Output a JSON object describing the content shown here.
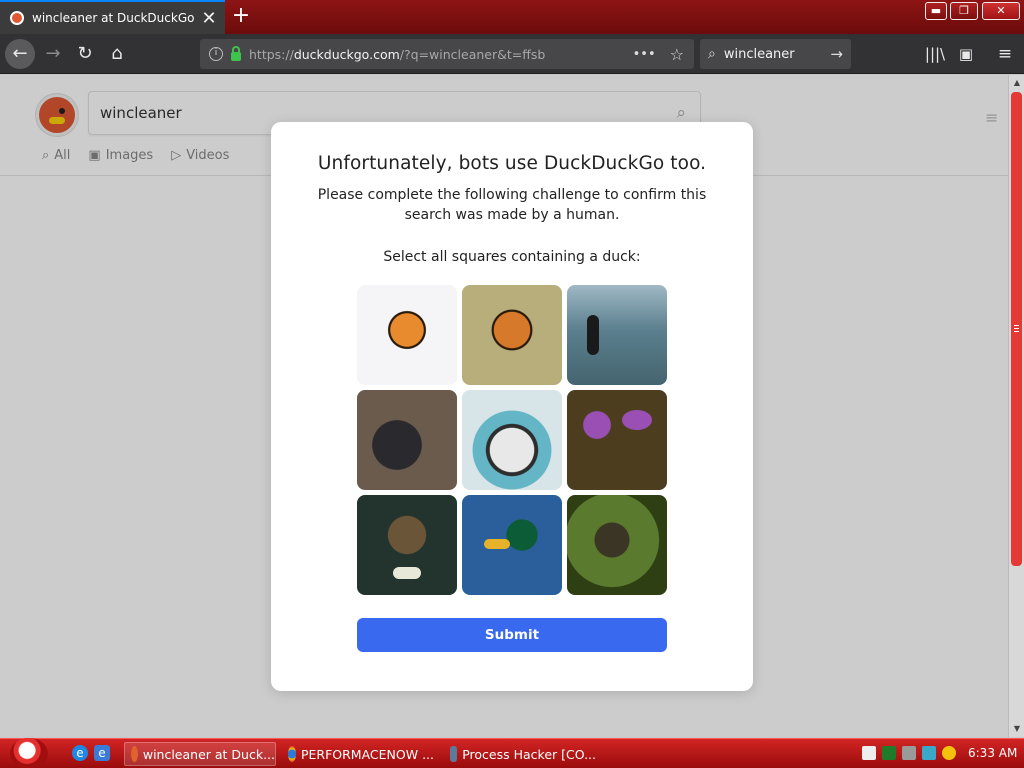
{
  "browser": {
    "tab": {
      "title": "wincleaner at DuckDuckGo",
      "close": "✕"
    },
    "new_tab": "+",
    "window": {
      "minimize": "▬",
      "maximize": "❐",
      "close": "✕"
    },
    "nav": {
      "back": "←",
      "forward": "→",
      "reload": "↻",
      "home": "⌂"
    },
    "url": {
      "scheme": "https://",
      "domain": "duckduckgo.com",
      "path": "/?q=wincleaner&t=ffsb",
      "more": "•••",
      "bookmark": "☆"
    },
    "search": {
      "value": "wincleaner",
      "go": "→"
    },
    "toolbar": {
      "library": "|||\\",
      "sidebar": "▣",
      "menu": "≡"
    }
  },
  "page": {
    "search_value": "wincleaner",
    "tabs": [
      {
        "icon": "⌕",
        "label": "All"
      },
      {
        "icon": "▣",
        "label": "Images"
      },
      {
        "icon": "▷",
        "label": "Videos"
      }
    ],
    "hamburger": "≡"
  },
  "challenge": {
    "heading": "Unfortunately, bots use DuckDuckGo too.",
    "subheading": "Please complete the following challenge to confirm this search was made by a human.",
    "instruction": "Select all squares containing a duck:",
    "tiles": [
      {
        "subject": "tiger-snow"
      },
      {
        "subject": "tiger-grass"
      },
      {
        "subject": "penguins-water"
      },
      {
        "subject": "black-ducks"
      },
      {
        "subject": "husky-flowers"
      },
      {
        "subject": "purple-orchids"
      },
      {
        "subject": "duck-perched"
      },
      {
        "subject": "mallard-water"
      },
      {
        "subject": "monkey-trees"
      }
    ],
    "submit_label": "Submit"
  },
  "taskbar": {
    "tasks": [
      {
        "label": "wincleaner at Duck..."
      },
      {
        "label": "PERFORMACENOW ..."
      },
      {
        "label": "Process Hacker [CO..."
      }
    ],
    "clock": "6:33 AM"
  },
  "colors": {
    "accent": "#3969ef",
    "tab_bar": "#8e1414",
    "taskbar": "#d22424",
    "secure_lock": "#3fc34f"
  }
}
